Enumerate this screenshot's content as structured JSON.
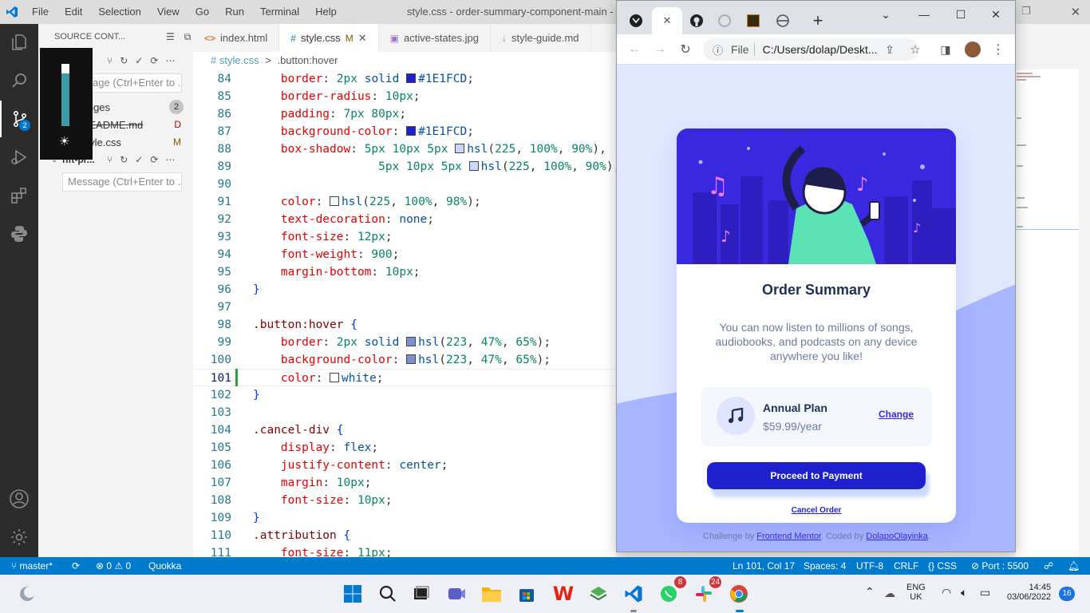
{
  "vscode": {
    "menu": [
      "File",
      "Edit",
      "Selection",
      "View",
      "Go",
      "Run",
      "Terminal",
      "Help"
    ],
    "window_title": "style.css - order-summary-component-main - Vis",
    "sidebar": {
      "header": "SOURCE CONT...",
      "message_placeholder": "Message (Ctrl+Enter to ...",
      "changes_label": "Changes",
      "changes_count": "2",
      "files": [
        {
          "name": "README.md",
          "status": "D"
        },
        {
          "name": "style.css",
          "status": "M"
        }
      ],
      "second_repo": "nft-pr...",
      "second_placeholder": "Message (Ctrl+Enter to ..."
    },
    "scm_badge": "2",
    "tabs": [
      {
        "label": "index.html",
        "icon": "<>",
        "modified": ""
      },
      {
        "label": "style.css",
        "icon": "#",
        "modified": "M"
      },
      {
        "label": "active-states.jpg",
        "icon": "img",
        "modified": ""
      },
      {
        "label": "style-guide.md",
        "icon": "md",
        "modified": ""
      }
    ],
    "breadcrumb": {
      "file": "# style.css",
      "sep": ">",
      "symbol": ".button:hover"
    },
    "current_line": "101",
    "status": {
      "branch": "master*",
      "errors": "0",
      "warnings": "0",
      "quokka": "Quokka",
      "position": "Ln 101, Col 17",
      "spaces": "Spaces: 4",
      "encoding": "UTF-8",
      "eol": "CRLF",
      "language": "CSS",
      "port": "Port : 5500"
    }
  },
  "taskbar": {
    "whatsapp_badge": "8",
    "slack_badge": "24",
    "lang_top": "ENG",
    "lang_bottom": "UK",
    "time": "14:45",
    "date": "03/06/2022",
    "notifications": "16"
  },
  "browser": {
    "address_scheme": "File",
    "address": "C:/Users/dolap/Deskt..."
  },
  "page": {
    "title": "Order Summary",
    "description": "You can now listen to millions of songs, audiobooks, and podcasts on any device anywhere you like!",
    "plan_name": "Annual Plan",
    "plan_price": "$59.99/year",
    "change_link": "Change",
    "pay_button": "Proceed to Payment",
    "cancel_link": "Cancel Order",
    "attribution_prefix": "Challenge by",
    "attribution_fm": "Frontend Mentor",
    "attribution_mid": ". Coded by",
    "attribution_author": "DolapoOlayinka",
    "attribution_end": "."
  },
  "colors": {
    "vscode_accent": "#007acc",
    "pay_button": "#1e1fcd",
    "hero_bg": "#3829e0",
    "page_bg": "#e0e8ff"
  }
}
